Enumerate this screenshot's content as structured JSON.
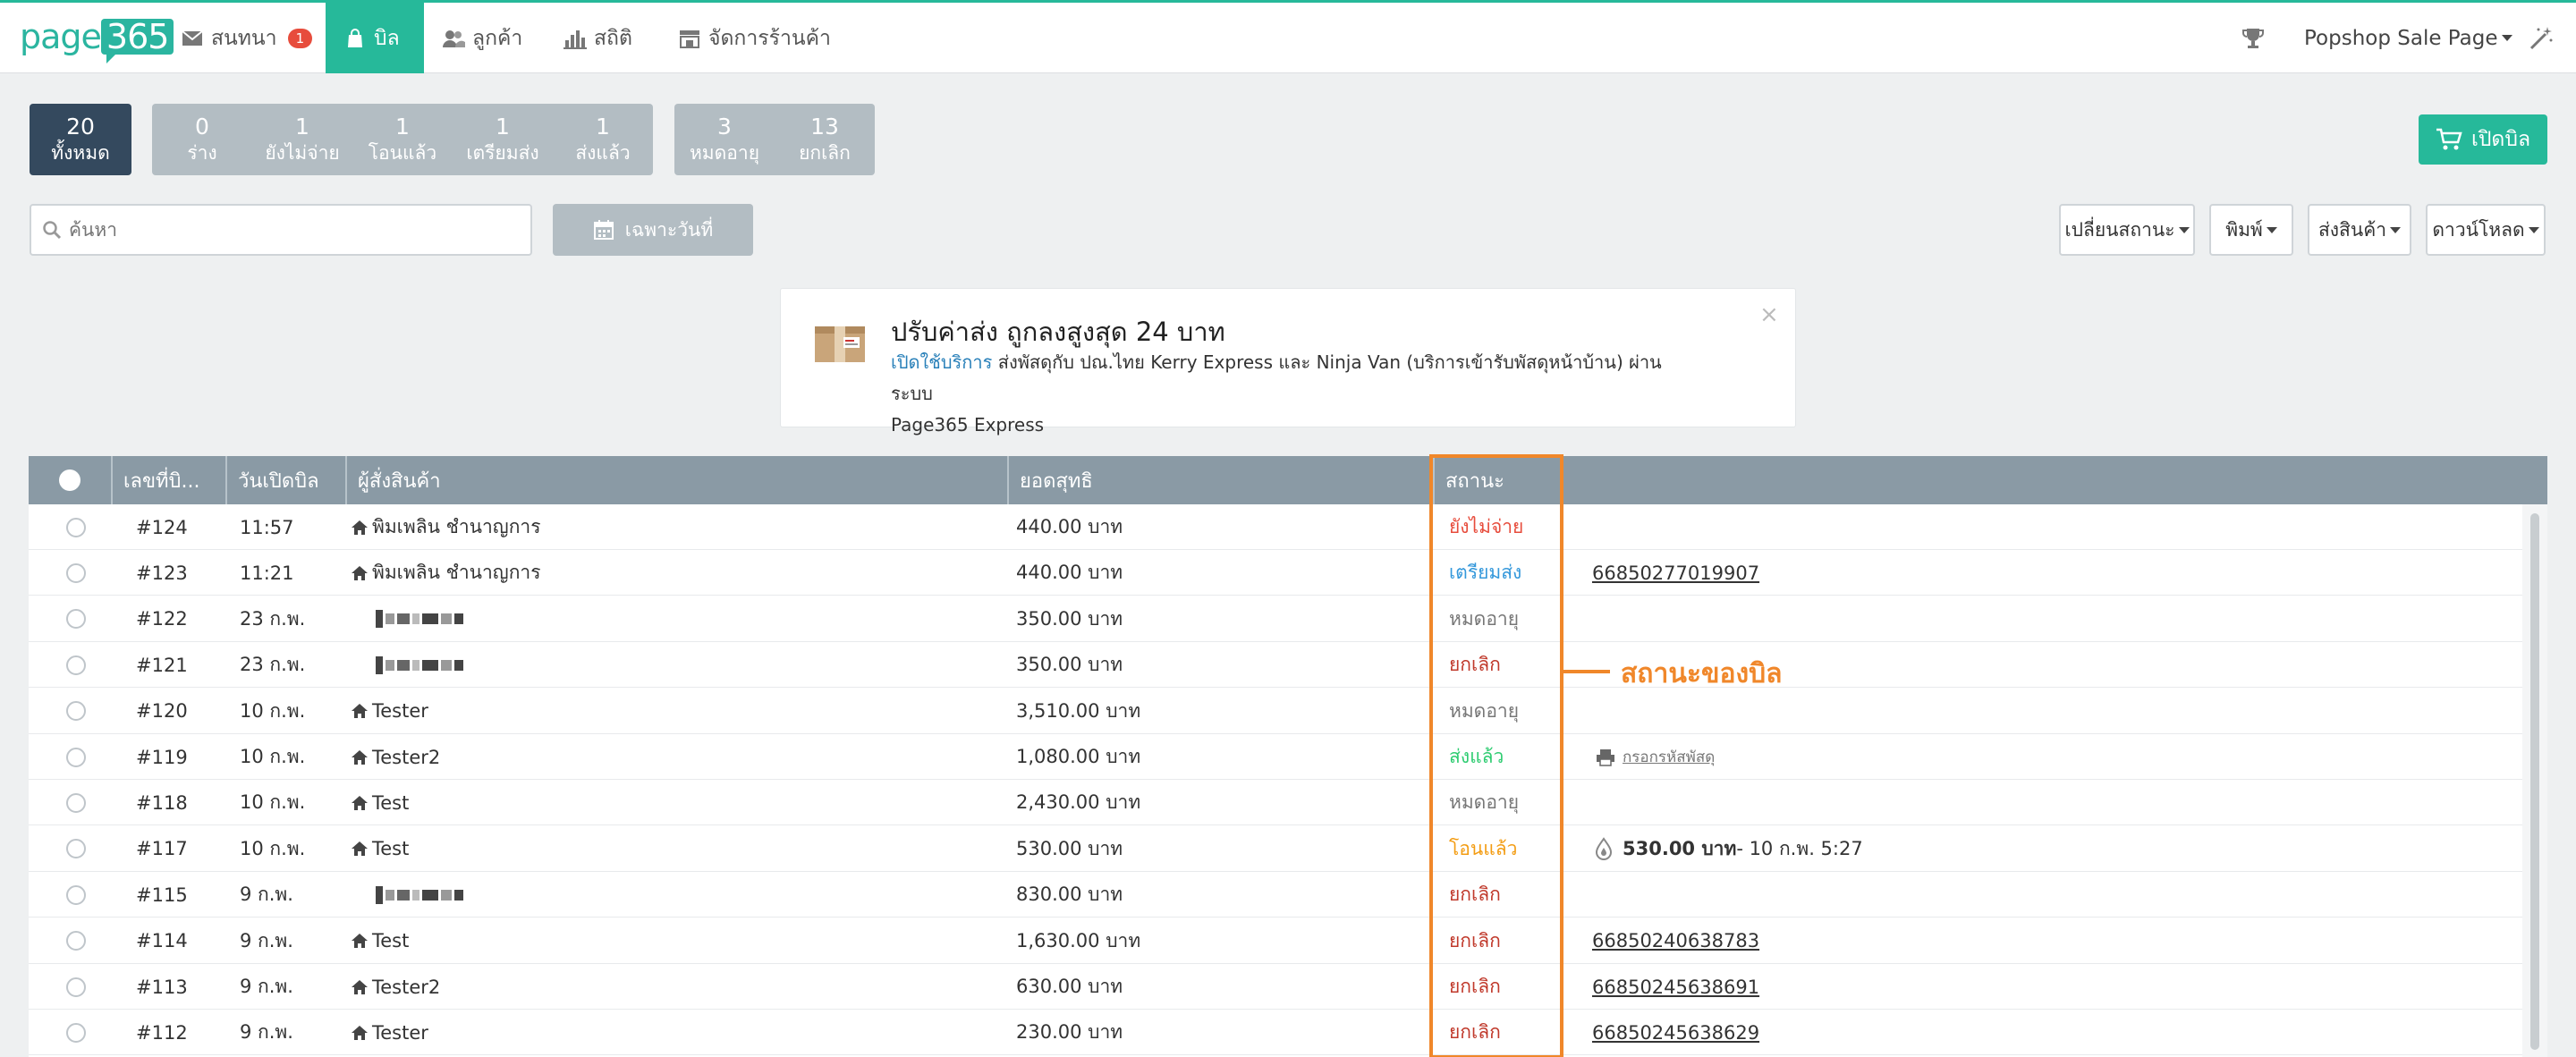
{
  "brand": {
    "logo_text": "page",
    "logo_box": "365",
    "color": "#26b99a"
  },
  "nav": {
    "items": [
      {
        "label": "สนทนา",
        "icon": "mail-icon",
        "badge": "1"
      },
      {
        "label": "บิล",
        "icon": "bag-icon",
        "active": true
      },
      {
        "label": "ลูกค้า",
        "icon": "users-icon"
      },
      {
        "label": "สถิติ",
        "icon": "bar-chart-icon"
      },
      {
        "label": "จัดการร้านค้า",
        "icon": "store-icon"
      }
    ],
    "page_name": "Popshop Sale Page",
    "right_icons": [
      "trophy-icon",
      "magic-wand-icon"
    ]
  },
  "filters": {
    "group1": [
      {
        "num": "20",
        "label": "ทั้งหมด",
        "active": true
      }
    ],
    "group2": [
      {
        "num": "0",
        "label": "ร่าง"
      },
      {
        "num": "1",
        "label": "ยังไม่จ่าย"
      },
      {
        "num": "1",
        "label": "โอนแล้ว"
      },
      {
        "num": "1",
        "label": "เตรียมส่ง"
      },
      {
        "num": "1",
        "label": "ส่งแล้ว"
      }
    ],
    "group3": [
      {
        "num": "3",
        "label": "หมดอายุ"
      },
      {
        "num": "13",
        "label": "ยกเลิก"
      }
    ]
  },
  "open_bill_button": "เปิดบิล",
  "search": {
    "placeholder": "ค้นหา",
    "date_button": "เฉพาะวันที่"
  },
  "dropdowns": [
    "เปลี่ยนสถานะ",
    "พิมพ์",
    "ส่งสินค้า",
    "ดาวน์โหลด"
  ],
  "notice": {
    "title": "ปรับค่าส่ง ถูกลงสูงสุด 24 บาท",
    "link": "เปิดใช้บริการ",
    "text": " ส่งพัสดุกับ ปณ.ไทย Kerry Express และ Ninja Van (บริการเข้ารับพัสดุหน้าบ้าน) ผ่านระบบ",
    "text2": "Page365 Express",
    "close": "×"
  },
  "table": {
    "headers": [
      "เลขที่บิ...",
      "วันเปิดบิล",
      "ผู้สั่งสินค้า",
      "ยอดสุทธิ",
      "สถานะ"
    ],
    "rows": [
      {
        "id": "#124",
        "date": "11:57",
        "customer": "พิมเพลิน ชำนาญการ",
        "home": true,
        "total": "440.00 บาท",
        "status": "ยังไม่จ่าย",
        "status_color": "#e74c3c",
        "extra": ""
      },
      {
        "id": "#123",
        "date": "11:21",
        "customer": "พิมเพลิน ชำนาญการ",
        "home": true,
        "total": "440.00 บาท",
        "status": "เตรียมส่ง",
        "status_color": "#3498db",
        "extra": "66850277019907",
        "extra_type": "tracking"
      },
      {
        "id": "#122",
        "date": "23 ก.พ.",
        "customer": "",
        "blur": true,
        "total": "350.00 บาท",
        "status": "หมดอายุ",
        "status_color": "#777777",
        "extra": ""
      },
      {
        "id": "#121",
        "date": "23 ก.พ.",
        "customer": "",
        "blur": true,
        "total": "350.00 บาท",
        "status": "ยกเลิก",
        "status_color": "#c0392b",
        "extra": ""
      },
      {
        "id": "#120",
        "date": "10 ก.พ.",
        "customer": "Tester",
        "home": true,
        "total": "3,510.00 บาท",
        "status": "หมดอายุ",
        "status_color": "#777777",
        "extra": ""
      },
      {
        "id": "#119",
        "date": "10 ก.พ.",
        "customer": "Tester2",
        "home": true,
        "total": "1,080.00 บาท",
        "status": "ส่งแล้ว",
        "status_color": "#2ecc71",
        "extra": "กรอกรหัสพัสดุ",
        "extra_type": "print"
      },
      {
        "id": "#118",
        "date": "10 ก.พ.",
        "customer": "Test",
        "home": true,
        "total": "2,430.00 บาท",
        "status": "หมดอายุ",
        "status_color": "#777777",
        "extra": ""
      },
      {
        "id": "#117",
        "date": "10 ก.พ.",
        "customer": "Test",
        "home": true,
        "total": "530.00 บาท",
        "status": "โอนแล้ว",
        "status_color": "#f39c12",
        "extra": "530.00 บาท",
        "extra_tail": "- 10 ก.พ. 5:27",
        "extra_type": "payment"
      },
      {
        "id": "#115",
        "date": "9 ก.พ.",
        "customer": "",
        "blur": true,
        "total": "830.00 บาท",
        "status": "ยกเลิก",
        "status_color": "#c0392b",
        "extra": ""
      },
      {
        "id": "#114",
        "date": "9 ก.พ.",
        "customer": "Test",
        "home": true,
        "total": "1,630.00 บาท",
        "status": "ยกเลิก",
        "status_color": "#c0392b",
        "extra": "66850240638783",
        "extra_type": "tracking"
      },
      {
        "id": "#113",
        "date": "9 ก.พ.",
        "customer": "Tester2",
        "home": true,
        "total": "630.00 บาท",
        "status": "ยกเลิก",
        "status_color": "#c0392b",
        "extra": "66850245638691",
        "extra_type": "tracking"
      },
      {
        "id": "#112",
        "date": "9 ก.พ.",
        "customer": "Tester",
        "home": true,
        "total": "230.00 บาท",
        "status": "ยกเลิก",
        "status_color": "#c0392b",
        "extra": "66850245638629",
        "extra_type": "tracking"
      }
    ]
  },
  "annotation": {
    "label": "สถานะของบิล",
    "color": "#f0872a"
  }
}
